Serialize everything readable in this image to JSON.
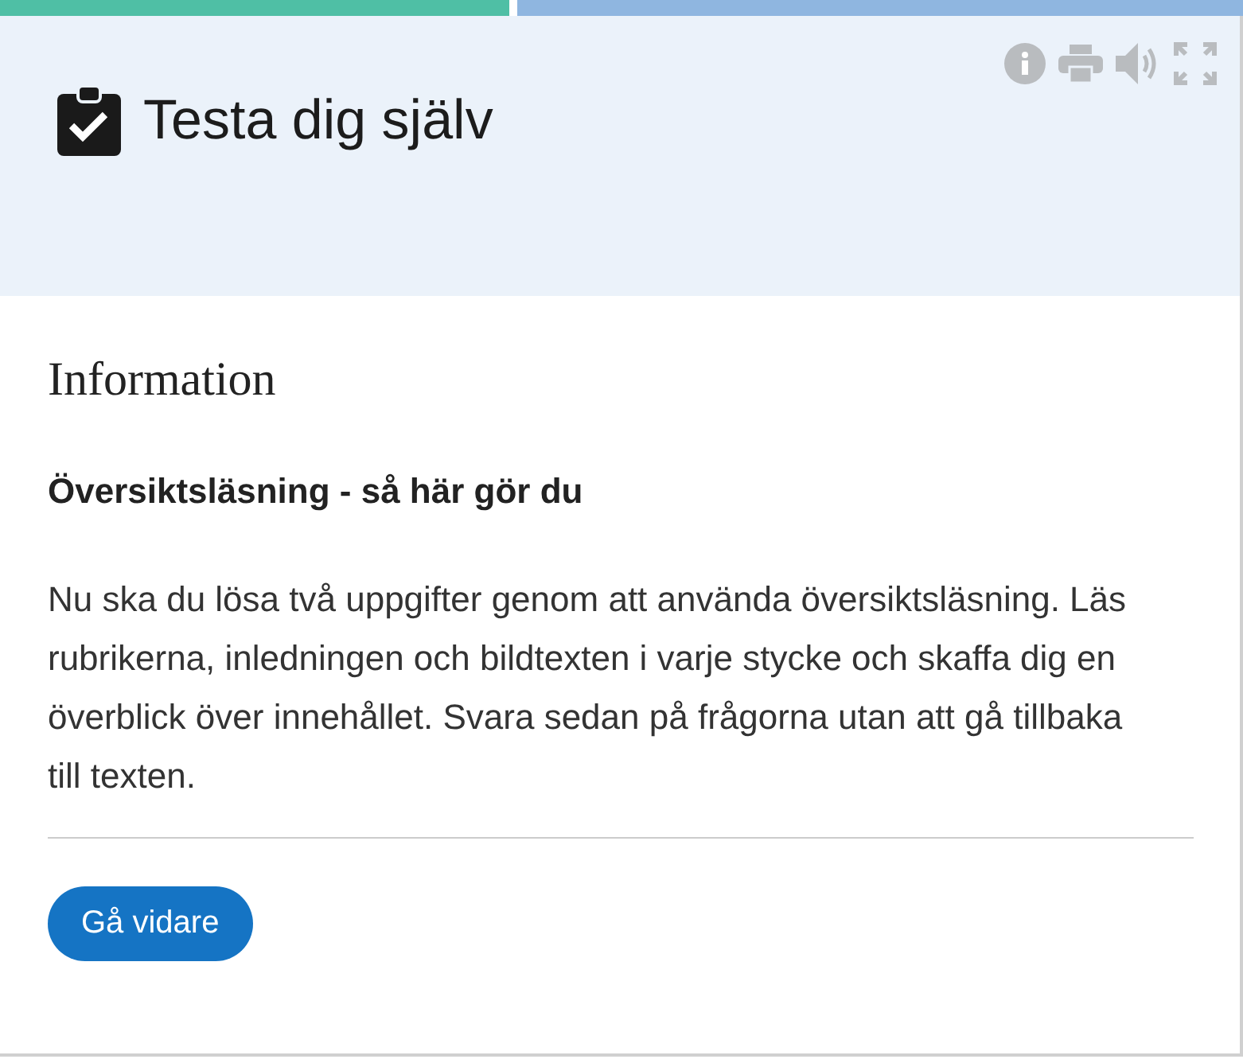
{
  "progress": {
    "level": 0.41
  },
  "header": {
    "title": "Testa dig själv",
    "tools": [
      {
        "kind": "info"
      },
      {
        "kind": "print"
      },
      {
        "kind": "speaker"
      },
      {
        "kind": "fullscreen"
      }
    ]
  },
  "section": {
    "title": "Information",
    "subtitle": "Översiktsläsning - så här gör du",
    "body": "Nu ska du lösa två uppgifter genom att använda översiktsläsning. Läs rubrikerna, inledningen och bildtexten i varje stycke och skaffa dig en överblick över innehållet. Svara sedan på frågorna utan att gå tillbaka till texten."
  },
  "button": {
    "label": "Gå vidare"
  }
}
